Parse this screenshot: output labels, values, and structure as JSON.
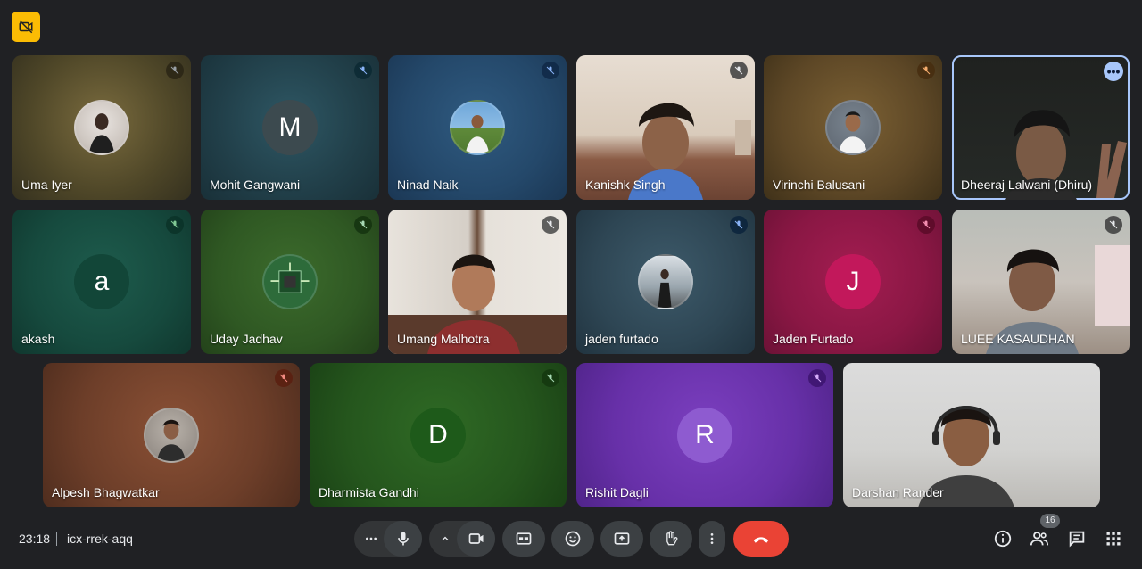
{
  "colors": {
    "background": "#202124",
    "control": "#3c4043",
    "end_call": "#ea4335",
    "badge": "#fbbc04",
    "highlight": "#a8c7fa"
  },
  "top_badge": {
    "icon": "no-video-icon"
  },
  "participants": [
    {
      "name": "Uma Iyer",
      "avatar": "photo",
      "mute": "mic-off-icon"
    },
    {
      "name": "Mohit Gangwani",
      "avatar": "letter",
      "initial": "M",
      "mute": "mic-off-icon"
    },
    {
      "name": "Ninad Naik",
      "avatar": "photo",
      "mute": "mic-off-icon"
    },
    {
      "name": "Kanishk Singh",
      "avatar": "video",
      "mute": "mic-off-icon"
    },
    {
      "name": "Virinchi Balusani",
      "avatar": "photo",
      "mute": "mic-off-icon"
    },
    {
      "name": "Dheeraj Lalwani (Dhiru)",
      "avatar": "video",
      "more": "more-options-icon"
    },
    {
      "name": "akash",
      "avatar": "letter",
      "initial": "a",
      "mute": "mic-off-icon"
    },
    {
      "name": "Uday Jadhav",
      "avatar": "photo",
      "mute": "mic-off-icon"
    },
    {
      "name": "Umang Malhotra",
      "avatar": "video",
      "mute": "mic-off-icon"
    },
    {
      "name": "jaden furtado",
      "avatar": "photo",
      "mute": "mic-off-icon"
    },
    {
      "name": "Jaden Furtado",
      "avatar": "letter",
      "initial": "J",
      "mute": "mic-off-icon"
    },
    {
      "name": "LUEE KASAUDHAN",
      "avatar": "video",
      "mute": "mic-off-icon"
    },
    {
      "name": "Alpesh Bhagwatkar",
      "avatar": "photo",
      "mute": "mic-off-icon"
    },
    {
      "name": "Dharmista Gandhi",
      "avatar": "letter",
      "initial": "D",
      "mute": "mic-off-icon"
    },
    {
      "name": "Rishit Dagli",
      "avatar": "letter",
      "initial": "R",
      "mute": "mic-off-icon"
    },
    {
      "name": "Darshan Rander",
      "avatar": "video"
    }
  ],
  "footer": {
    "time": "23:18",
    "separator": "|",
    "meeting_code": "icx-rrek-aqq",
    "participant_count": "16"
  },
  "controls": [
    {
      "icon": "more-horiz-icon"
    },
    {
      "icon": "mic-icon"
    },
    {
      "icon": "chevron-up-icon"
    },
    {
      "icon": "camera-icon"
    },
    {
      "icon": "captions-icon"
    },
    {
      "icon": "emoji-icon"
    },
    {
      "icon": "present-screen-icon"
    },
    {
      "icon": "raise-hand-icon"
    },
    {
      "icon": "more-vert-icon"
    },
    {
      "icon": "end-call-icon"
    }
  ],
  "right_icons": [
    {
      "icon": "info-icon"
    },
    {
      "icon": "people-icon"
    },
    {
      "icon": "chat-icon"
    },
    {
      "icon": "activities-icon"
    }
  ]
}
